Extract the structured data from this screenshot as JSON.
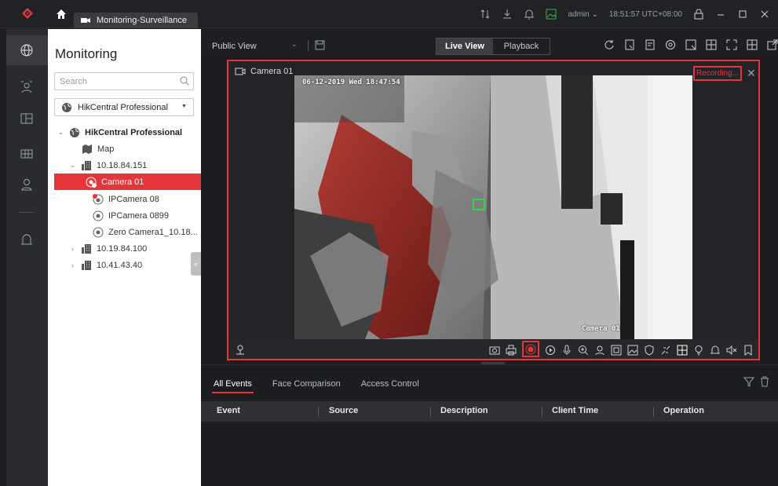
{
  "titlebar": {
    "tab_label": "Monitoring-Surveillance",
    "user": "admin",
    "time": "18:51:57 UTC+08:00"
  },
  "rail": {
    "items": [
      "globe-icon",
      "person-icon",
      "layout-icon",
      "grid-icon",
      "user-icon",
      "alarm-icon"
    ]
  },
  "tree": {
    "title": "Monitoring",
    "search_placeholder": "Search",
    "site_select": "HikCentral Professional",
    "nodes": [
      {
        "label": "HikCentral Professional"
      },
      {
        "label": "Map"
      },
      {
        "label": "10.18.84.151"
      },
      {
        "label": "Camera 01"
      },
      {
        "label": "IPCamera 08"
      },
      {
        "label": "IPCamera 0899"
      },
      {
        "label": "Zero Camera1_10.18..."
      },
      {
        "label": "10.19.84.100"
      },
      {
        "label": "10.41.43.40"
      }
    ]
  },
  "toolbar": {
    "view": "Public View",
    "live_label": "Live View",
    "playback_label": "Playback"
  },
  "camera": {
    "title": "Camera 01",
    "recording": "Recording...",
    "timestamp": "06-12-2019 Wed 18:47:54",
    "osd_name": "Camera 01"
  },
  "events": {
    "tabs": [
      "All Events",
      "Face Comparison",
      "Access Control"
    ],
    "columns": [
      "Event",
      "Source",
      "Description",
      "Client Time",
      "Operation"
    ]
  },
  "colors": {
    "accent": "#e5353b",
    "background": "#1e1f22",
    "panel": "#ffffff"
  }
}
